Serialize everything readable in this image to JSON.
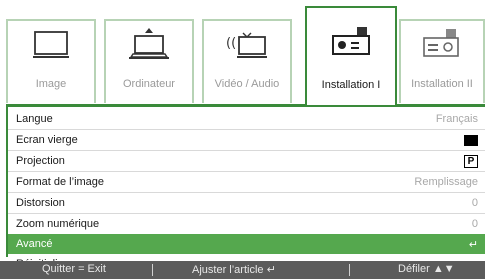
{
  "tabs": [
    {
      "label": "Image",
      "icon": "monitor-icon",
      "active": false
    },
    {
      "label": "Ordinateur",
      "icon": "computer-icon",
      "active": false
    },
    {
      "label": "Vidéo / Audio",
      "icon": "video-audio-icon",
      "active": false
    },
    {
      "label": "Installation I",
      "icon": "projector-icon",
      "active": true
    },
    {
      "label": "Installation II",
      "icon": "projector-icon",
      "active": false
    }
  ],
  "menu": {
    "items": [
      {
        "label": "Langue",
        "value": "Français"
      },
      {
        "label": "Ecran vierge",
        "value_icon": "black-square-icon"
      },
      {
        "label": "Projection",
        "value": "P"
      },
      {
        "label": "Format de l’image",
        "value": "Remplissage"
      },
      {
        "label": "Distorsion",
        "value": "0"
      },
      {
        "label": "Zoom numérique",
        "value": "0"
      },
      {
        "label": "Avancé",
        "value": "↵",
        "selected": true
      },
      {
        "label": "Réinitialiser",
        "value": "↵"
      }
    ]
  },
  "footer": {
    "quit": "Quitter = Exit",
    "adjust": "Ajuster l’article ↵",
    "scroll": "Défiler ▲▼"
  },
  "colors": {
    "accent": "#3a8a3a",
    "selected_row": "#55a84e",
    "footer_bg": "#5b5b5b"
  }
}
